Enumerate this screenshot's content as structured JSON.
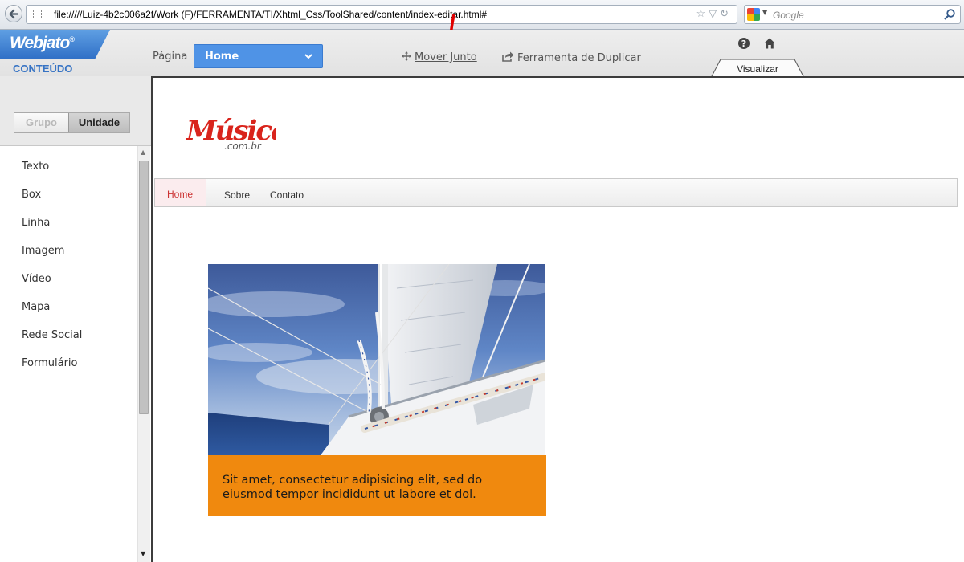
{
  "browser": {
    "url": "file://///Luiz-4b2c006a2f/Work  (F)/FERRAMENTA/TI/Xhtml_Css/ToolShared/content/index-editar.html#",
    "search_placeholder": "Google"
  },
  "app": {
    "logo": "Webjato",
    "logo_mark": "®",
    "section_title": "CONTEÚDO",
    "page_label": "Página",
    "page_select_value": "Home",
    "move_action": "Mover Junto",
    "duplicate_action": "Ferramenta de Duplicar",
    "preview_tab": "Visualizar",
    "icons": [
      "help-icon",
      "home-icon",
      "move-icon",
      "share-icon"
    ]
  },
  "panel": {
    "segment": {
      "off_label": "Grupo",
      "on_label": "Unidade"
    },
    "elements": [
      "Texto",
      "Box",
      "Linha",
      "Imagem",
      "Vídeo",
      "Mapa",
      "Rede Social",
      "Formulário"
    ]
  },
  "site": {
    "logo_text": "Música",
    "logo_sub": ".com.br",
    "nav": {
      "home": "Home",
      "about": "Sobre",
      "contact": "Contato"
    },
    "caption_line1": "Sit amet, consectetur adipisicing elit, sed do",
    "caption_line2": "eiusmod tempor incididunt ut  labore et dol."
  },
  "colors": {
    "brand_blue": "#3673c4",
    "select_blue": "#4f93e6",
    "caption_orange": "#f0890e",
    "logo_red": "#d9241c",
    "nav_active_text": "#cc3333"
  }
}
